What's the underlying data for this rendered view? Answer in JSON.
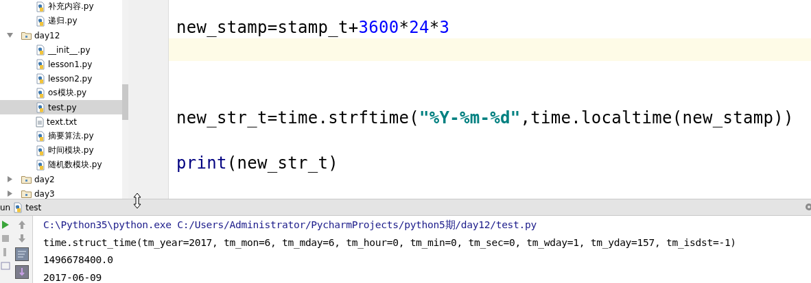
{
  "project_tree": [
    {
      "kind": "python_file",
      "label": "补充内容.py",
      "selected": false
    },
    {
      "kind": "python_file",
      "label": "递归.py",
      "selected": false
    },
    {
      "kind": "folder",
      "label": "day12",
      "expanded": true,
      "children": [
        {
          "kind": "python_file",
          "label": "__init__.py",
          "selected": false
        },
        {
          "kind": "python_file",
          "label": "lesson1.py",
          "selected": false
        },
        {
          "kind": "python_file",
          "label": "lesson2.py",
          "selected": false
        },
        {
          "kind": "python_file",
          "label": "os模块.py",
          "selected": false
        },
        {
          "kind": "python_file",
          "label": "test.py",
          "selected": true
        },
        {
          "kind": "text_file",
          "label": "text.txt",
          "selected": false
        },
        {
          "kind": "python_file",
          "label": "摘要算法.py",
          "selected": false
        },
        {
          "kind": "python_file",
          "label": "时间模块.py",
          "selected": false
        },
        {
          "kind": "python_file",
          "label": "随机数模块.py",
          "selected": false
        }
      ]
    },
    {
      "kind": "folder",
      "label": "day2",
      "expanded": false
    },
    {
      "kind": "folder",
      "label": "day3",
      "expanded": false
    }
  ],
  "editor": {
    "lines": [
      {
        "kind": "code",
        "tokens": [
          {
            "kind": "plain",
            "text": "new_stamp=stamp_t+"
          },
          {
            "kind": "number",
            "text": "3600"
          },
          {
            "kind": "plain",
            "text": "*"
          },
          {
            "kind": "number",
            "text": "24"
          },
          {
            "kind": "plain",
            "text": "*"
          },
          {
            "kind": "number",
            "text": "3"
          }
        ]
      },
      {
        "kind": "blank",
        "current": true
      },
      {
        "kind": "blank"
      },
      {
        "kind": "blank"
      },
      {
        "kind": "code",
        "tokens": [
          {
            "kind": "plain",
            "text": "new_str_t=time.strftime("
          },
          {
            "kind": "string",
            "text": "\"%Y-%m-%d\""
          },
          {
            "kind": "plain",
            "text": ",time.localtime(new_stamp))"
          }
        ]
      },
      {
        "kind": "blank"
      },
      {
        "kind": "code",
        "tokens": [
          {
            "kind": "builtin",
            "text": "print"
          },
          {
            "kind": "plain",
            "text": "(new_str_t)"
          }
        ]
      }
    ]
  },
  "run_panel": {
    "title": "un",
    "config": "test",
    "output": [
      {
        "kind": "command",
        "text": "C:\\Python35\\python.exe C:/Users/Administrator/PycharmProjects/python5期/day12/test.py"
      },
      {
        "kind": "stdout",
        "text": "time.struct_time(tm_year=2017, tm_mon=6, tm_mday=6, tm_hour=0, tm_min=0, tm_sec=0, tm_wday=1, tm_yday=157, tm_isdst=-1)"
      },
      {
        "kind": "stdout",
        "text": "1496678400.0"
      },
      {
        "kind": "stdout",
        "text": "2017-06-09"
      }
    ]
  }
}
